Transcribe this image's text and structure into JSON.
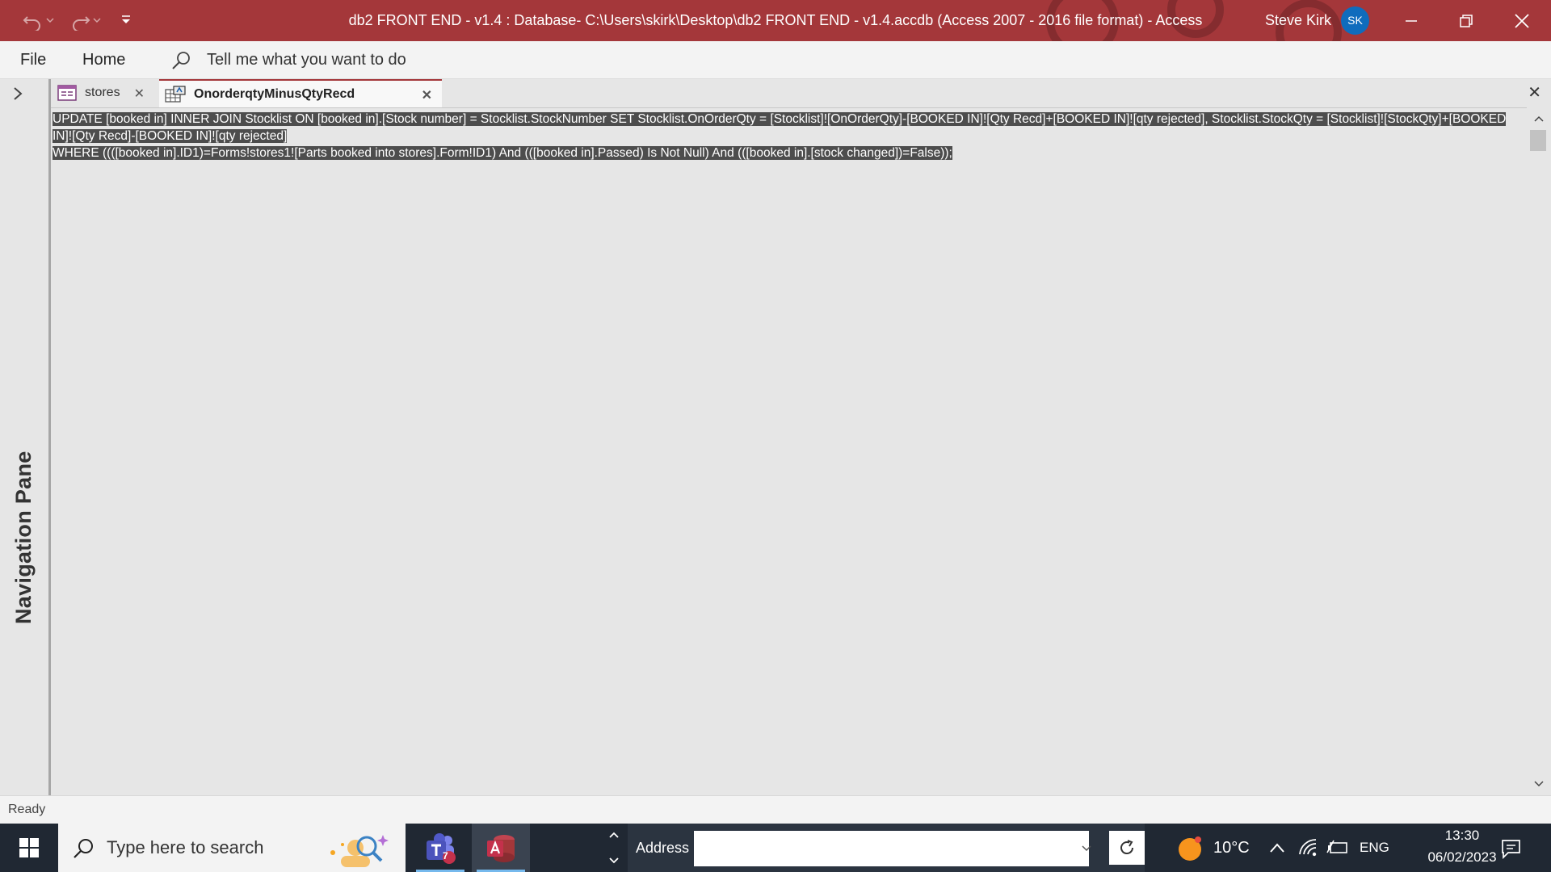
{
  "window": {
    "title": "db2 FRONT END - v1.4 : Database- C:\\Users\\skirk\\Desktop\\db2 FRONT END - v1.4.accdb (Access 2007 - 2016 file format)  -  Access",
    "user_name": "Steve Kirk",
    "user_initials": "SK"
  },
  "ribbon": {
    "tabs": [
      "File",
      "Home"
    ],
    "tell_me": "Tell me what you want to do"
  },
  "nav_pane": {
    "label": "Navigation Pane"
  },
  "doc_tabs": [
    {
      "label": "stores",
      "icon": "form-icon",
      "active": false
    },
    {
      "label": "OnorderqtyMinusQtyRecd",
      "icon": "update-query-icon",
      "active": true
    }
  ],
  "sql": {
    "line1": "UPDATE [booked in] INNER JOIN Stocklist ON [booked in].[Stock number] = Stocklist.StockNumber SET Stocklist.OnOrderQty = [Stocklist]![OnOrderQty]-[BOOKED IN]![Qty Recd]+[BOOKED IN]![qty rejected], Stocklist.StockQty = [Stocklist]![StockQty]+[BOOKED IN]![Qty Recd]-[BOOKED IN]![qty rejected]",
    "line2": "WHERE ((([booked in].ID1)=Forms!stores1![Parts booked into stores].Form!ID1) And (([booked in].Passed) Is Not Null) And (([booked in].[stock changed])=False));"
  },
  "status": {
    "text": "Ready"
  },
  "taskbar": {
    "search_placeholder": "Type here to search",
    "teams_badge": "7",
    "address_label": "Address",
    "address_value": "",
    "weather_temp": "10°C",
    "language": "ENG",
    "time": "13:30",
    "date": "06/02/2023"
  },
  "colors": {
    "title_bar": "#a4373a",
    "avatar": "#0f6cbd",
    "taskbar": "#202833",
    "selection": "#4d4d4d"
  }
}
